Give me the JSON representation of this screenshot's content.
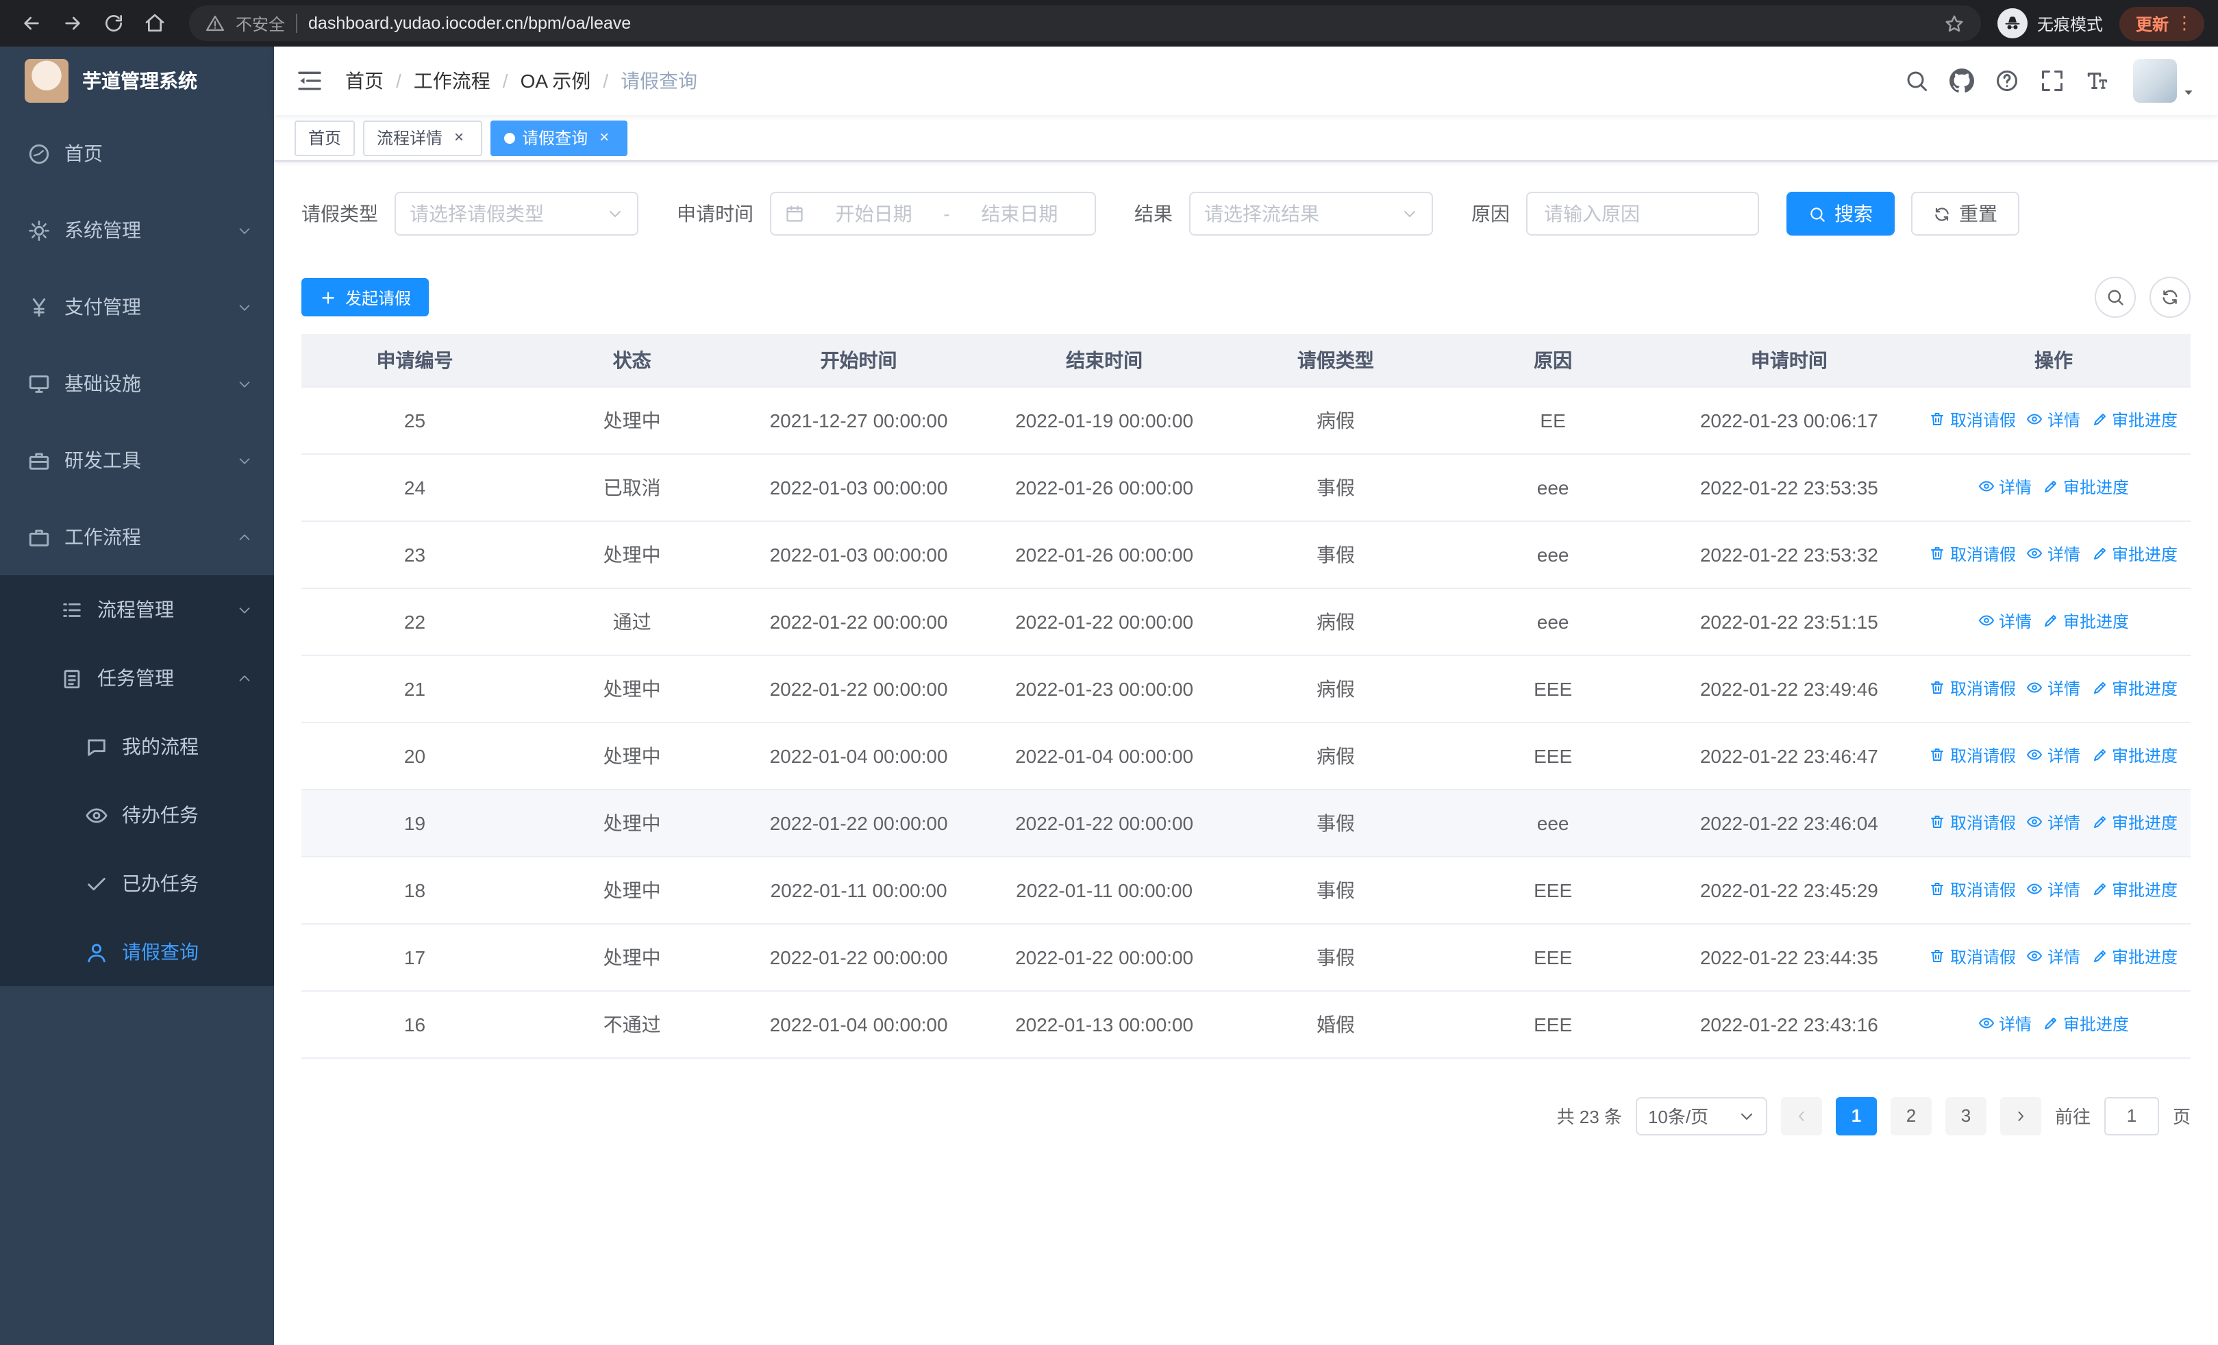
{
  "colors": {
    "accent": "#1890ff",
    "active_tab_bg": "#409eff",
    "sidebar_bg": "#304156",
    "submenu_bg": "#1f2d3d",
    "sidebar_text": "#bfcbd9",
    "sidebar_active_text": "#409eff",
    "chrome_bg": "#202124",
    "update_badge_text": "#ff8a65",
    "table_header_bg": "#f0f2f5"
  },
  "browser": {
    "security_label": "不安全",
    "url": "dashboard.yudao.iocoder.cn/bpm/oa/leave",
    "incognito_label": "无痕模式",
    "update_label": "更新"
  },
  "sidebar": {
    "logo_title": "芋道管理系统",
    "items": [
      {
        "key": "home",
        "label": "首页",
        "icon": "dashboard-icon",
        "level": 1,
        "expandable": false,
        "expanded": false,
        "active": false
      },
      {
        "key": "system-mgmt",
        "label": "系统管理",
        "icon": "gear-icon",
        "level": 1,
        "expandable": true,
        "expanded": false,
        "active": false
      },
      {
        "key": "payment-mgmt",
        "label": "支付管理",
        "icon": "yen-icon",
        "level": 1,
        "expandable": true,
        "expanded": false,
        "active": false
      },
      {
        "key": "infrastructure",
        "label": "基础设施",
        "icon": "monitor-icon",
        "level": 1,
        "expandable": true,
        "expanded": false,
        "active": false
      },
      {
        "key": "dev-tools",
        "label": "研发工具",
        "icon": "toolbox-icon",
        "level": 1,
        "expandable": true,
        "expanded": false,
        "active": false
      },
      {
        "key": "workflow",
        "label": "工作流程",
        "icon": "briefcase-icon",
        "level": 1,
        "expandable": true,
        "expanded": true,
        "active": false
      },
      {
        "key": "process-mgmt",
        "label": "流程管理",
        "icon": "list-icon",
        "level": 2,
        "expandable": true,
        "expanded": false,
        "active": false
      },
      {
        "key": "task-mgmt",
        "label": "任务管理",
        "icon": "clipboard-icon",
        "level": 2,
        "expandable": true,
        "expanded": true,
        "active": false
      },
      {
        "key": "my-process",
        "label": "我的流程",
        "icon": "chat-icon",
        "level": 3,
        "expandable": false,
        "expanded": false,
        "active": false
      },
      {
        "key": "todo-task",
        "label": "待办任务",
        "icon": "eye-icon",
        "level": 3,
        "expandable": false,
        "expanded": false,
        "active": false
      },
      {
        "key": "done-task",
        "label": "已办任务",
        "icon": "check-icon",
        "level": 3,
        "expandable": false,
        "expanded": false,
        "active": false
      },
      {
        "key": "leave-query",
        "label": "请假查询",
        "icon": "user-icon",
        "level": 3,
        "expandable": false,
        "expanded": false,
        "active": true
      }
    ]
  },
  "header": {
    "breadcrumb": [
      "首页",
      "工作流程",
      "OA 示例",
      "请假查询"
    ]
  },
  "tabs": [
    {
      "label": "首页",
      "active": false,
      "closable": false
    },
    {
      "label": "流程详情",
      "active": false,
      "closable": true
    },
    {
      "label": "请假查询",
      "active": true,
      "closable": true
    }
  ],
  "filters": {
    "leave_type": {
      "label": "请假类型",
      "placeholder": "请选择请假类型"
    },
    "apply_time": {
      "label": "申请时间",
      "start_placeholder": "开始日期",
      "separator": "-",
      "end_placeholder": "结束日期"
    },
    "result": {
      "label": "结果",
      "placeholder": "请选择流结果"
    },
    "reason": {
      "label": "原因",
      "placeholder": "请输入原因"
    },
    "search_label": "搜索",
    "reset_label": "重置"
  },
  "toolbar": {
    "create_label": "发起请假"
  },
  "table": {
    "columns": [
      "申请编号",
      "状态",
      "开始时间",
      "结束时间",
      "请假类型",
      "原因",
      "申请时间",
      "操作"
    ],
    "action_defs": [
      {
        "key": "cancel",
        "label": "取消请假",
        "icon": "trash-icon"
      },
      {
        "key": "detail",
        "label": "详情",
        "icon": "eye-icon"
      },
      {
        "key": "progress",
        "label": "审批进度",
        "icon": "pen-icon"
      }
    ],
    "rows": [
      {
        "id": "25",
        "status": "处理中",
        "start": "2021-12-27 00:00:00",
        "end": "2022-01-19 00:00:00",
        "type": "病假",
        "reason": "EE",
        "apply_time": "2022-01-23 00:06:17",
        "actions": [
          "cancel",
          "detail",
          "progress"
        ],
        "highlighted": false
      },
      {
        "id": "24",
        "status": "已取消",
        "start": "2022-01-03 00:00:00",
        "end": "2022-01-26 00:00:00",
        "type": "事假",
        "reason": "eee",
        "apply_time": "2022-01-22 23:53:35",
        "actions": [
          "detail",
          "progress"
        ],
        "highlighted": false
      },
      {
        "id": "23",
        "status": "处理中",
        "start": "2022-01-03 00:00:00",
        "end": "2022-01-26 00:00:00",
        "type": "事假",
        "reason": "eee",
        "apply_time": "2022-01-22 23:53:32",
        "actions": [
          "cancel",
          "detail",
          "progress"
        ],
        "highlighted": false
      },
      {
        "id": "22",
        "status": "通过",
        "start": "2022-01-22 00:00:00",
        "end": "2022-01-22 00:00:00",
        "type": "病假",
        "reason": "eee",
        "apply_time": "2022-01-22 23:51:15",
        "actions": [
          "detail",
          "progress"
        ],
        "highlighted": false
      },
      {
        "id": "21",
        "status": "处理中",
        "start": "2022-01-22 00:00:00",
        "end": "2022-01-23 00:00:00",
        "type": "病假",
        "reason": "EEE",
        "apply_time": "2022-01-22 23:49:46",
        "actions": [
          "cancel",
          "detail",
          "progress"
        ],
        "highlighted": false
      },
      {
        "id": "20",
        "status": "处理中",
        "start": "2022-01-04 00:00:00",
        "end": "2022-01-04 00:00:00",
        "type": "病假",
        "reason": "EEE",
        "apply_time": "2022-01-22 23:46:47",
        "actions": [
          "cancel",
          "detail",
          "progress"
        ],
        "highlighted": false
      },
      {
        "id": "19",
        "status": "处理中",
        "start": "2022-01-22 00:00:00",
        "end": "2022-01-22 00:00:00",
        "type": "事假",
        "reason": "eee",
        "apply_time": "2022-01-22 23:46:04",
        "actions": [
          "cancel",
          "detail",
          "progress"
        ],
        "highlighted": true
      },
      {
        "id": "18",
        "status": "处理中",
        "start": "2022-01-11 00:00:00",
        "end": "2022-01-11 00:00:00",
        "type": "事假",
        "reason": "EEE",
        "apply_time": "2022-01-22 23:45:29",
        "actions": [
          "cancel",
          "detail",
          "progress"
        ],
        "highlighted": false
      },
      {
        "id": "17",
        "status": "处理中",
        "start": "2022-01-22 00:00:00",
        "end": "2022-01-22 00:00:00",
        "type": "事假",
        "reason": "EEE",
        "apply_time": "2022-01-22 23:44:35",
        "actions": [
          "cancel",
          "detail",
          "progress"
        ],
        "highlighted": false
      },
      {
        "id": "16",
        "status": "不通过",
        "start": "2022-01-04 00:00:00",
        "end": "2022-01-13 00:00:00",
        "type": "婚假",
        "reason": "EEE",
        "apply_time": "2022-01-22 23:43:16",
        "actions": [
          "detail",
          "progress"
        ],
        "highlighted": false
      }
    ]
  },
  "pagination": {
    "total_label": "共 23 条",
    "page_size": "10条/页",
    "pages": [
      "1",
      "2",
      "3"
    ],
    "active_page": "1",
    "goto_label": "前往",
    "goto_value": "1",
    "unit_label": "页"
  }
}
